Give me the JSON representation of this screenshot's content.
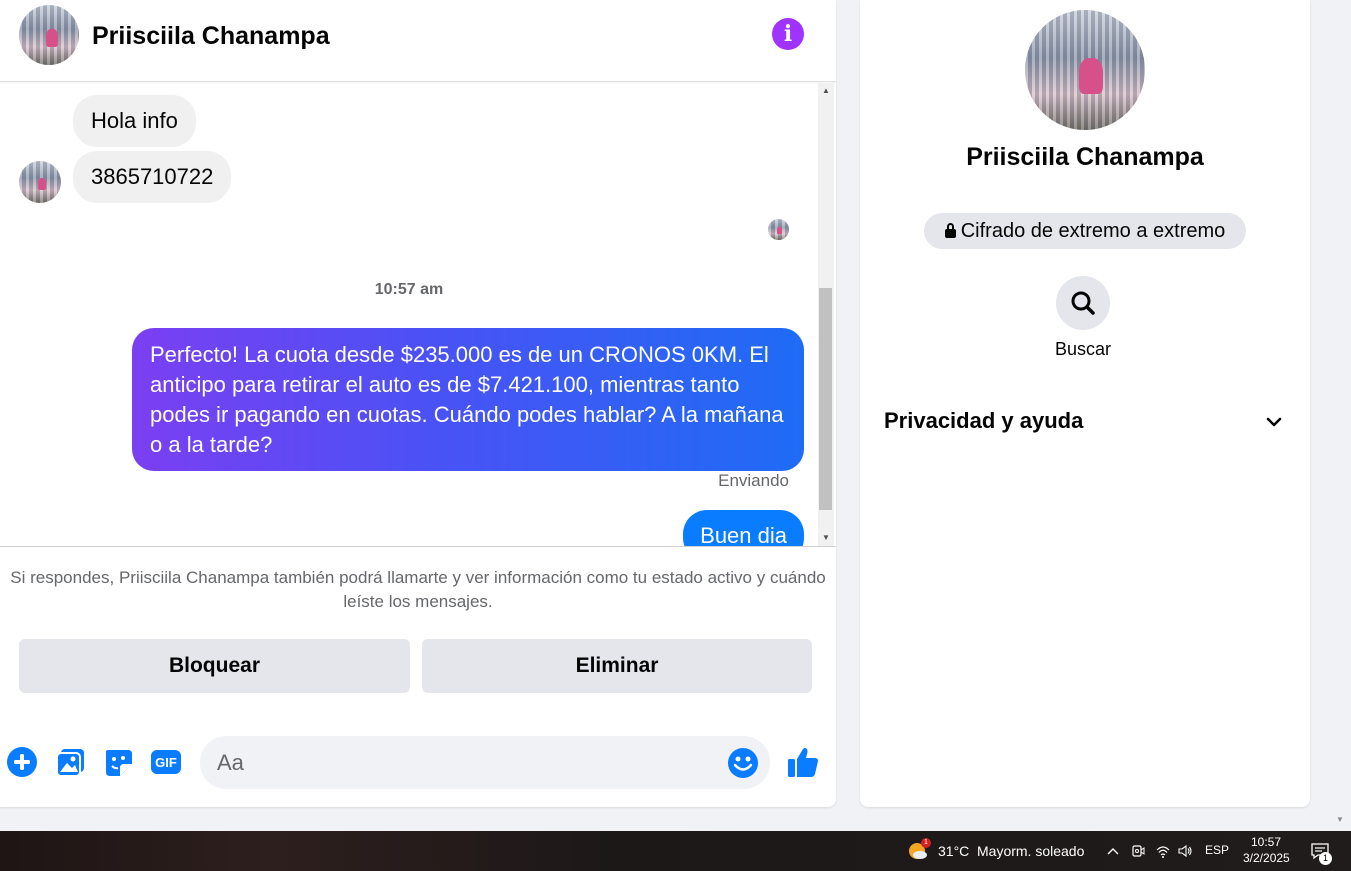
{
  "header": {
    "contact_name": "Priisciila Chanampa"
  },
  "messages": {
    "incoming": [
      "Hola info",
      "3865710722"
    ],
    "timestamp": "10:57 am",
    "outgoing_main": "Perfecto! La cuota desde $235.000 es de un CRONOS 0KM. El anticipo para retirar el auto es de $7.421.100, mientras tanto podes ir pagando en cuotas. Cuándo podes hablar? A la mañana o a la tarde?",
    "status": "Enviando",
    "outgoing_partial": "Buen dia"
  },
  "request": {
    "notice": "Si respondes, Priisciila Chanampa también podrá llamarte y ver información como tu estado activo y cuándo leíste los mensajes.",
    "block_label": "Bloquear",
    "delete_label": "Eliminar"
  },
  "composer": {
    "placeholder": "Aa"
  },
  "side": {
    "name": "Priisciila Chanampa",
    "encryption": "Cifrado de extremo a extremo",
    "search_label": "Buscar",
    "privacy_label": "Privacidad y ayuda"
  },
  "taskbar": {
    "weather_badge": "1",
    "temperature": "31°C",
    "condition": "Mayorm. soleado",
    "language": "ESP",
    "time": "10:57",
    "date": "3/2/2025",
    "notifications": "1"
  },
  "colors": {
    "accent": "#0a7cff",
    "info": "#a033ff",
    "gradient_start": "#7b3ff2",
    "gradient_end": "#1e6cf5"
  }
}
